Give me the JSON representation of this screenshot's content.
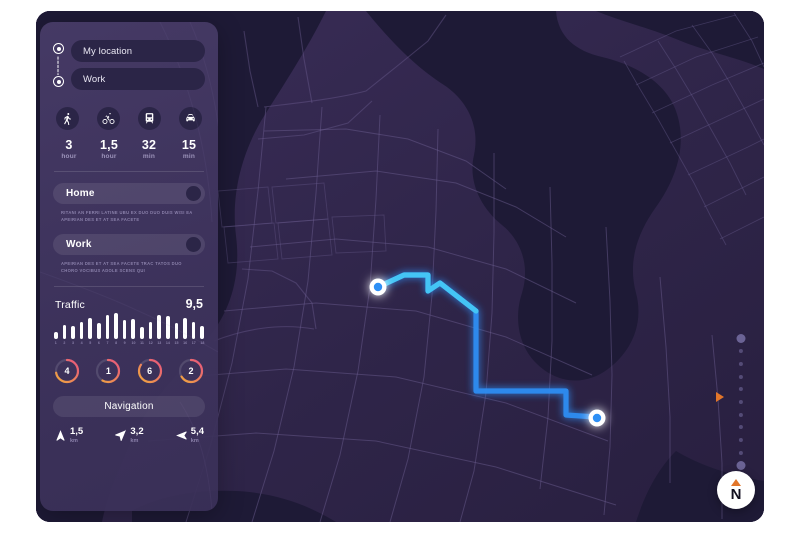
{
  "theme": {
    "page_bg": "#ffffff",
    "frame_bg": "#241f3d",
    "map_land": "#2e2449",
    "map_water": "#1e1a36",
    "panel_bg": "#483c68",
    "route_color": "#2e8ff5",
    "route_color_light": "#46c8f5",
    "accent_orange": "#e2762a",
    "text_primary": "#ffffff",
    "text_muted": "#8b81ab"
  },
  "panel": {
    "route_inputs": [
      {
        "name": "origin",
        "value": "My location",
        "marker": "circle-target-icon"
      },
      {
        "name": "destination",
        "value": "Work",
        "marker": "circle-target-icon"
      }
    ],
    "transport_modes": [
      {
        "icon": "walk-icon",
        "label": "Walking",
        "time_value": "3",
        "time_unit": "hour"
      },
      {
        "icon": "bicycle-icon",
        "label": "Bicycle",
        "time_value": "1,5",
        "time_unit": "hour"
      },
      {
        "icon": "tram-icon",
        "label": "Transit",
        "time_value": "32",
        "time_unit": "min"
      },
      {
        "icon": "car-icon",
        "label": "Car",
        "time_value": "15",
        "time_unit": "min"
      }
    ],
    "places": [
      {
        "label": "Home",
        "description": "RITANI AN FERRI LATINE UBU EX DUO DUO DUIS WISI EA APEIRIAN DES ET AT SEA FACETE"
      },
      {
        "label": "Work",
        "description": "APEIRIAN DES ET AT SEA FACETE TRAC TATOS DUO CHORO VOCIBUS ADOLE SCENS QUI"
      }
    ],
    "traffic": {
      "label": "Traffic",
      "value": "9,5"
    },
    "stats_rings": [
      {
        "value": "4",
        "percent": 72
      },
      {
        "value": "1",
        "percent": 58
      },
      {
        "value": "6",
        "percent": 84
      },
      {
        "value": "2",
        "percent": 66
      }
    ],
    "navigation_button": "Navigation",
    "nav_directions": [
      {
        "icon": "arrow-straight-icon",
        "value": "1,5",
        "unit": "km"
      },
      {
        "icon": "arrow-right-turn-icon",
        "value": "3,2",
        "unit": "km"
      },
      {
        "icon": "arrow-left-turn-icon",
        "value": "5,4",
        "unit": "km"
      }
    ]
  },
  "chart_data": {
    "type": "bar",
    "title": "Traffic",
    "categories": [
      "1",
      "2",
      "3",
      "4",
      "5",
      "6",
      "7",
      "8",
      "9",
      "10",
      "11",
      "12",
      "13",
      "14",
      "15",
      "16",
      "17",
      "18"
    ],
    "values": [
      5,
      10,
      9,
      12,
      15,
      11,
      17,
      18,
      13,
      14,
      8,
      12,
      17,
      16,
      11,
      15,
      12,
      9
    ],
    "ylim": [
      0,
      20
    ],
    "xlabel": "",
    "ylabel": "",
    "grid": false,
    "legend": false,
    "summary_value": "9,5"
  },
  "map": {
    "route": {
      "start_label": "route-start-marker",
      "end_label": "route-end-marker"
    },
    "compass": {
      "label": "N",
      "icon": "compass-north-icon"
    },
    "zoom_slider": {
      "name": "map-zoom-slider",
      "steps": 11,
      "marker": "orange-triangle-marker"
    }
  }
}
